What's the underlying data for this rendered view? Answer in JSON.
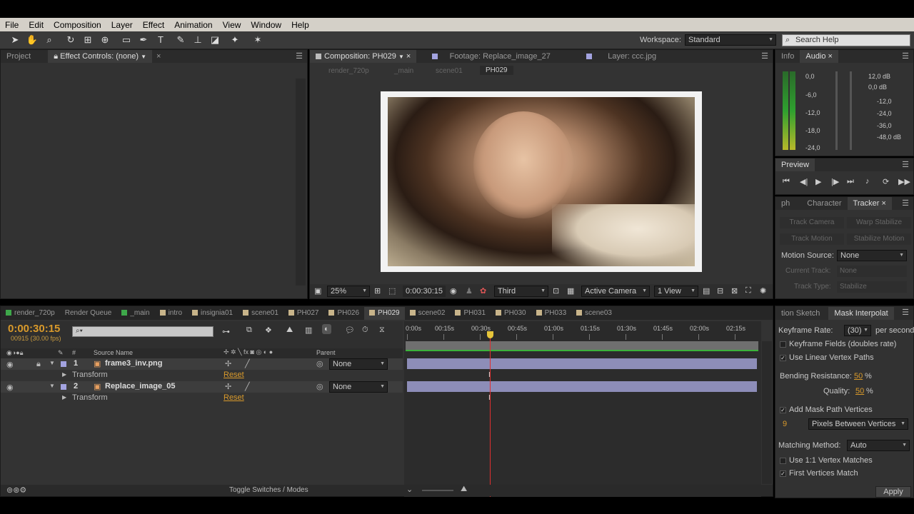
{
  "menu": [
    "File",
    "Edit",
    "Composition",
    "Layer",
    "Effect",
    "Animation",
    "View",
    "Window",
    "Help"
  ],
  "workspace": {
    "label": "Workspace:",
    "value": "Standard"
  },
  "search_help": "Search Help",
  "left_panel": {
    "tab_project": "Project",
    "tab_effect": "Effect Controls: (none)"
  },
  "comp_panel": {
    "tab_comp": "Composition: PH029",
    "tab_footage": "Footage: Replace_image_27",
    "tab_layer": "Layer: ccc.jpg",
    "breadcrumbs": [
      "render_720p",
      "_main",
      "scene01",
      "PH029"
    ],
    "zoom": "25%",
    "timecode": "0:00:30:15",
    "resolution": "Third",
    "camera": "Active Camera",
    "views": "1 View"
  },
  "info_panel": {
    "tab_info": "Info",
    "tab_audio": "Audio",
    "left_db": [
      "0,0",
      "-6,0",
      "-12,0",
      "-18,0",
      "-24,0"
    ],
    "right_db": [
      "12,0 dB",
      "0,0 dB",
      "-12,0",
      "-24,0",
      "-36,0",
      "-48,0 dB"
    ]
  },
  "preview_panel": {
    "title": "Preview"
  },
  "tracker_panel": {
    "tabs": [
      "ph",
      "Character",
      "Tracker"
    ],
    "track_camera": "Track Camera",
    "warp_stabilize": "Warp Stabilize",
    "track_motion": "Track Motion",
    "stabilize_motion": "Stabilize Motion",
    "motion_source_label": "Motion Source:",
    "motion_source_value": "None",
    "current_track_label": "Current Track:",
    "current_track_value": "None",
    "track_type_label": "Track Type:",
    "track_type_value": "Stabilize"
  },
  "timeline_tabs": [
    {
      "label": "render_720p",
      "color": "#3ea84a"
    },
    {
      "label": "Render Queue",
      "color": ""
    },
    {
      "label": "_main",
      "color": "#3ea84a"
    },
    {
      "label": "intro",
      "color": "#c8b48a"
    },
    {
      "label": "insignia01",
      "color": "#c8b48a"
    },
    {
      "label": "scene01",
      "color": "#c8b48a"
    },
    {
      "label": "PH027",
      "color": "#c8b48a"
    },
    {
      "label": "PH026",
      "color": "#c8b48a"
    },
    {
      "label": "PH029",
      "color": "#c8b48a"
    },
    {
      "label": "scene02",
      "color": "#c8b48a"
    },
    {
      "label": "PH031",
      "color": "#c8b48a"
    },
    {
      "label": "PH030",
      "color": "#c8b48a"
    },
    {
      "label": "PH033",
      "color": "#c8b48a"
    },
    {
      "label": "scene03",
      "color": "#c8b48a"
    }
  ],
  "timeline": {
    "timecode": "0:00:30:15",
    "frames": "00915 (30.00 fps)",
    "col_source": "Source Name",
    "col_parent": "Parent",
    "ruler": [
      "0:00s",
      "00:15s",
      "00:30s",
      "00:45s",
      "01:00s",
      "01:15s",
      "01:30s",
      "01:45s",
      "02:00s",
      "02:15s"
    ],
    "current_time_fraction": 0.232,
    "layers": [
      {
        "num": "1",
        "name": "frame3_inv.png",
        "parent": "None",
        "sub": "Transform",
        "reset": "Reset"
      },
      {
        "num": "2",
        "name": "Replace_image_05",
        "parent": "None",
        "sub": "Transform",
        "reset": "Reset"
      }
    ],
    "toggle": "Toggle Switches / Modes"
  },
  "mask_panel": {
    "tab_sketch": "tion Sketch",
    "tab_mask": "Mask Interpolat",
    "keyframe_rate_label": "Keyframe Rate:",
    "keyframe_rate_value": "(30)",
    "per_second": "per second",
    "keyframe_fields": "Keyframe Fields (doubles rate)",
    "linear_vertex": "Use Linear Vertex Paths",
    "bending_label": "Bending Resistance:",
    "bending_value": "50",
    "quality_label": "Quality:",
    "quality_value": "50",
    "percent": "%",
    "add_vertices": "Add Mask Path Vertices",
    "vertex_count": "9",
    "vertex_mode": "Pixels Between Vertices",
    "matching_label": "Matching Method:",
    "matching_value": "Auto",
    "one_to_one": "Use 1:1 Vertex Matches",
    "first_vertices": "First Vertices Match",
    "apply": "Apply"
  }
}
